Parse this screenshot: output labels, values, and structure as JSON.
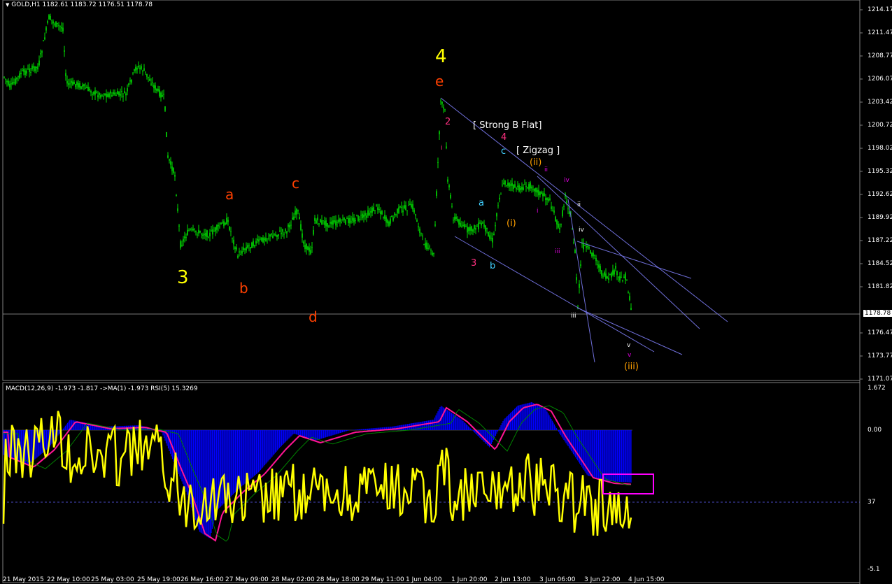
{
  "main_header": "GOLD,H1  1182.61 1183.72 1176.51 1178.78",
  "indicator_header": "MACD(12,26,9) -1.973 -1.817  ->MA(1) -1.973  RSI(5) 15.3269",
  "price_axis": [
    "1214.17",
    "1211.47",
    "1208.77",
    "1206.07",
    "1203.42",
    "1200.72",
    "1198.02",
    "1195.32",
    "1192.62",
    "1189.92",
    "1187.22",
    "1184.52",
    "1181.82",
    "1176.47",
    "1173.77",
    "1171.07"
  ],
  "current_price": "1178.78",
  "indicator_axis": [
    "1.672",
    "0.00",
    "37",
    "-5.1"
  ],
  "time_axis": [
    "21 May 2015",
    "22 May 10:00",
    "25 May 03:00",
    "25 May 19:00",
    "26 May 16:00",
    "27 May 09:00",
    "28 May 02:00",
    "28 May 18:00",
    "29 May 11:00",
    "1 Jun 04:00",
    "1 Jun 20:00",
    "2 Jun 13:00",
    "3 Jun 06:00",
    "3 Jun 22:00",
    "4 Jun 15:00"
  ],
  "wave_labels": [
    {
      "text": "4",
      "color": "#ffff00",
      "size": "big"
    },
    {
      "text": "e",
      "color": "#ff4000",
      "size": "mid"
    },
    {
      "text": "3",
      "color": "#ffff00",
      "size": "big"
    },
    {
      "text": "a",
      "color": "#ff4000",
      "size": "mid"
    },
    {
      "text": "b",
      "color": "#ff4000",
      "size": "mid"
    },
    {
      "text": "c",
      "color": "#ff4000",
      "size": "mid"
    },
    {
      "text": "d",
      "color": "#ff4000",
      "size": "mid"
    },
    {
      "text": "2",
      "color": "#ff3080",
      "size": "small"
    },
    {
      "text": "4",
      "color": "#ff3080",
      "size": "small"
    },
    {
      "text": "3",
      "color": "#ff3080",
      "size": "small"
    },
    {
      "text": "a",
      "color": "#40d0ff",
      "size": "small"
    },
    {
      "text": "b",
      "color": "#40d0ff",
      "size": "small"
    },
    {
      "text": "c",
      "color": "#40d0ff",
      "size": "small"
    },
    {
      "text": "[ Strong B Flat]",
      "color": "#ffffff",
      "size": "small"
    },
    {
      "text": "[ Zigzag ]",
      "color": "#ffffff",
      "size": "small"
    },
    {
      "text": "(ii)",
      "color": "#ffa000",
      "size": "small"
    },
    {
      "text": "(i)",
      "color": "#ffa000",
      "size": "small"
    },
    {
      "text": "(iii)",
      "color": "#ffa000",
      "size": "small"
    },
    {
      "text": "i",
      "color": "#e000e0",
      "size": "tiny"
    },
    {
      "text": "ii",
      "color": "#e000e0",
      "size": "tiny"
    },
    {
      "text": "iii",
      "color": "#e000e0",
      "size": "tiny"
    },
    {
      "text": "iv",
      "color": "#e000e0",
      "size": "tiny"
    },
    {
      "text": "v",
      "color": "#e000e0",
      "size": "tiny"
    },
    {
      "text": "ii",
      "color": "#ffffff",
      "size": "tiny"
    },
    {
      "text": "iii",
      "color": "#ffffff",
      "size": "tiny"
    },
    {
      "text": "iv",
      "color": "#ffffff",
      "size": "tiny"
    },
    {
      "text": "v",
      "color": "#ffffff",
      "size": "tiny"
    },
    {
      "text": "i",
      "color": "#ff3080",
      "size": "tiny"
    }
  ],
  "colors": {
    "candle": "#00e000",
    "channel": "#6e6ed8",
    "macd_hist": "#0000ff",
    "macd_signal": "#ff1493",
    "rsi": "#ffff00",
    "ma": "#008000",
    "highlight": "#ff00ff"
  }
}
